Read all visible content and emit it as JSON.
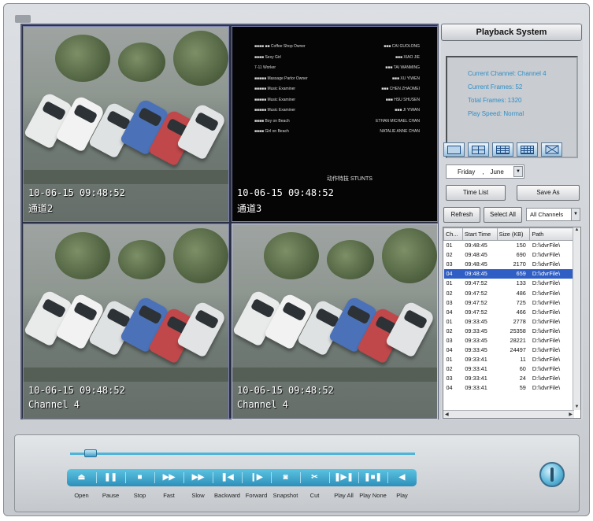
{
  "videos": [
    {
      "timestamp": "10-06-15 09:48:52",
      "channel": "通道2"
    },
    {
      "timestamp": "10-06-15 09:48:52",
      "channel": "通道3"
    },
    {
      "timestamp": "10-06-15 09:48:52",
      "channel": "Channel 4"
    },
    {
      "timestamp": "10-06-15 09:48:52",
      "channel": "Channel 4"
    }
  ],
  "stunts": "动作特技 STUNTS",
  "header": {
    "title": "Playback System"
  },
  "info": {
    "current_channel": "Current Channel: Channel 4",
    "current_frames": "Current Frames: 52",
    "total_frames": "Total Frames: 1320",
    "play_speed": "Play Speed: Normal"
  },
  "date": {
    "day": "Friday",
    "sep": ",",
    "month": "June"
  },
  "buttons": {
    "time_list": "Time List",
    "save_as": "Save As",
    "refresh": "Refresh",
    "select_all": "Select All"
  },
  "channel_select": "All Channels",
  "table": {
    "headers": [
      "Ch...",
      "Start Time",
      "Size (KB)",
      "Path"
    ],
    "rows": [
      [
        "01",
        "09:48:45",
        "150",
        "D:\\\\dvrFile\\"
      ],
      [
        "02",
        "09:48:45",
        "690",
        "D:\\\\dvrFile\\"
      ],
      [
        "03",
        "09:48:45",
        "2170",
        "D:\\\\dvrFile\\"
      ],
      [
        "04",
        "09:48:45",
        "659",
        "D:\\\\dvrFile\\"
      ],
      [
        "01",
        "09:47:52",
        "133",
        "D:\\\\dvrFile\\"
      ],
      [
        "02",
        "09:47:52",
        "486",
        "D:\\\\dvrFile\\"
      ],
      [
        "03",
        "09:47:52",
        "725",
        "D:\\\\dvrFile\\"
      ],
      [
        "04",
        "09:47:52",
        "466",
        "D:\\\\dvrFile\\"
      ],
      [
        "01",
        "09:33:45",
        "2778",
        "D:\\\\dvrFile\\"
      ],
      [
        "02",
        "09:33:45",
        "25358",
        "D:\\\\dvrFile\\"
      ],
      [
        "03",
        "09:33:45",
        "28221",
        "D:\\\\dvrFile\\"
      ],
      [
        "04",
        "09:33:45",
        "24497",
        "D:\\\\dvrFile\\"
      ],
      [
        "01",
        "09:33:41",
        "11",
        "D:\\\\dvrFile\\"
      ],
      [
        "02",
        "09:33:41",
        "60",
        "D:\\\\dvrFile\\"
      ],
      [
        "03",
        "09:33:41",
        "24",
        "D:\\\\dvrFile\\"
      ],
      [
        "04",
        "09:33:41",
        "59",
        "D:\\\\dvrFile\\"
      ]
    ],
    "selected_row": 3
  },
  "controls": [
    {
      "label": "Open",
      "icon": "eject-icon"
    },
    {
      "label": "Pause",
      "icon": "pause-icon"
    },
    {
      "label": "Stop",
      "icon": "stop-icon"
    },
    {
      "label": "Fast",
      "icon": "fast-forward-icon"
    },
    {
      "label": "Slow",
      "icon": "slow-icon"
    },
    {
      "label": "Backward",
      "icon": "step-backward-icon"
    },
    {
      "label": "Forward",
      "icon": "step-forward-icon"
    },
    {
      "label": "Snapshot",
      "icon": "camera-icon"
    },
    {
      "label": "Cut",
      "icon": "cut-icon"
    },
    {
      "label": "Play All",
      "icon": "play-all-icon"
    },
    {
      "label": "Play None",
      "icon": "play-none-icon"
    },
    {
      "label": "Play",
      "icon": "play-icon"
    }
  ],
  "playback_position": 0.04,
  "colors": {
    "accent": "#3aa7d3",
    "info_text": "#2e8ec6",
    "selection": "#2f5fc4"
  }
}
